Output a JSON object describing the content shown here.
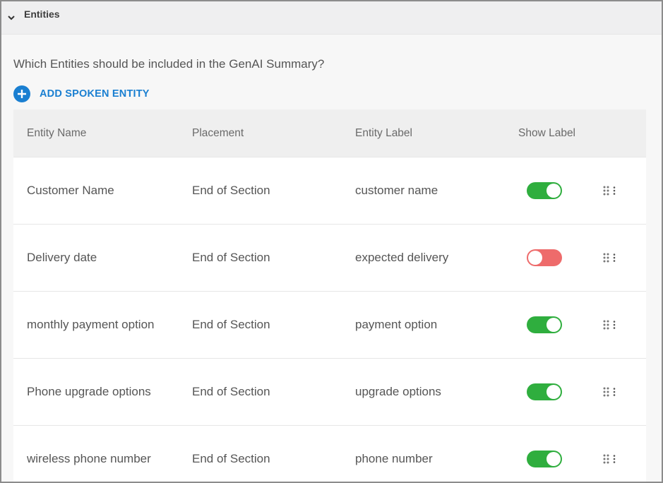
{
  "section": {
    "title": "Entities",
    "chevron_icon": "chevron-down-icon"
  },
  "question": "Which Entities should be included in the GenAI Summary?",
  "add_button": {
    "label": "ADD SPOKEN ENTITY",
    "icon": "plus-circle-icon",
    "color": "#1a7fd1"
  },
  "table": {
    "headers": [
      "Entity Name",
      "Placement",
      "Entity Label",
      "Show Label"
    ],
    "rows": [
      {
        "name": "Customer Name",
        "placement": "End of Section",
        "label": "customer name",
        "show_label": true
      },
      {
        "name": "Delivery date",
        "placement": "End of Section",
        "label": "expected delivery",
        "show_label": false
      },
      {
        "name": "monthly payment option",
        "placement": "End of Section",
        "label": "payment option",
        "show_label": true
      },
      {
        "name": "Phone upgrade options",
        "placement": "End of Section",
        "label": "upgrade options",
        "show_label": true
      },
      {
        "name": "wireless phone number",
        "placement": "End of Section",
        "label": "phone number",
        "show_label": true
      }
    ]
  },
  "colors": {
    "toggle_on": "#2fae3e",
    "toggle_off": "#ee6b6b"
  }
}
